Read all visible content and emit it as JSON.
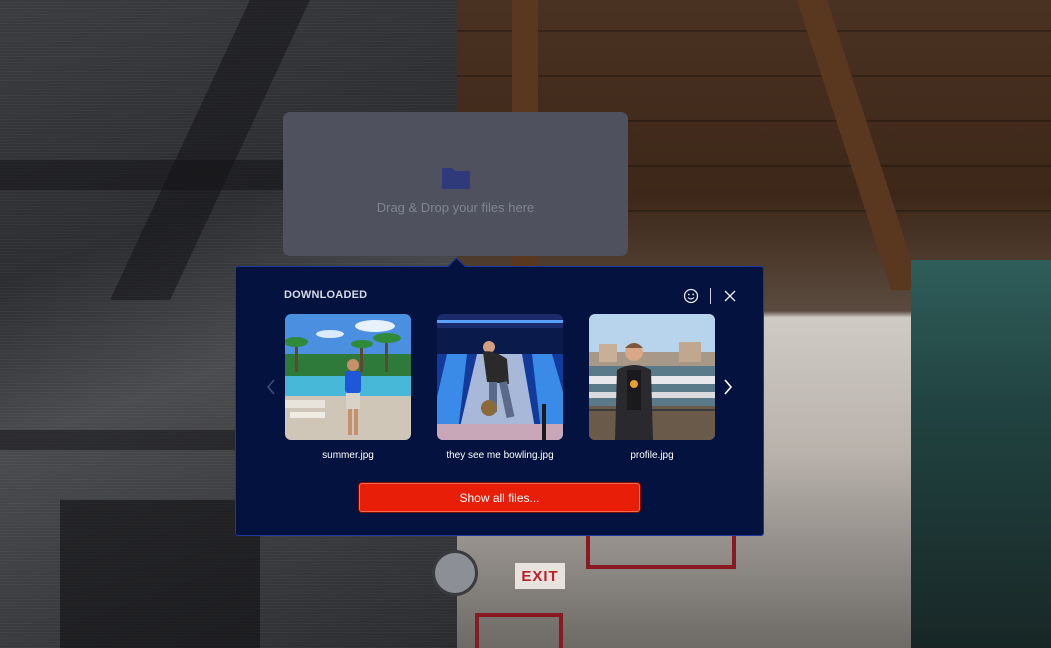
{
  "dropzone": {
    "text": "Drag & Drop your files here",
    "icon": "folder-icon",
    "icon_color": "#2f3a7a"
  },
  "downloads": {
    "title": "DOWNLOADED",
    "emoji_icon": "smiley-icon",
    "close_icon": "close-icon",
    "prev_icon": "chevron-left-icon",
    "next_icon": "chevron-right-icon",
    "files": [
      {
        "name": "summer.jpg"
      },
      {
        "name": "they see me bowling.jpg"
      },
      {
        "name": "profile.jpg"
      }
    ],
    "show_all_label": "Show all files...",
    "colors": {
      "panel_bg": "#04123f",
      "panel_border": "#1c3a9c",
      "button_bg": "#e81e08"
    }
  },
  "background": {
    "exit_sign": "EXIT"
  }
}
